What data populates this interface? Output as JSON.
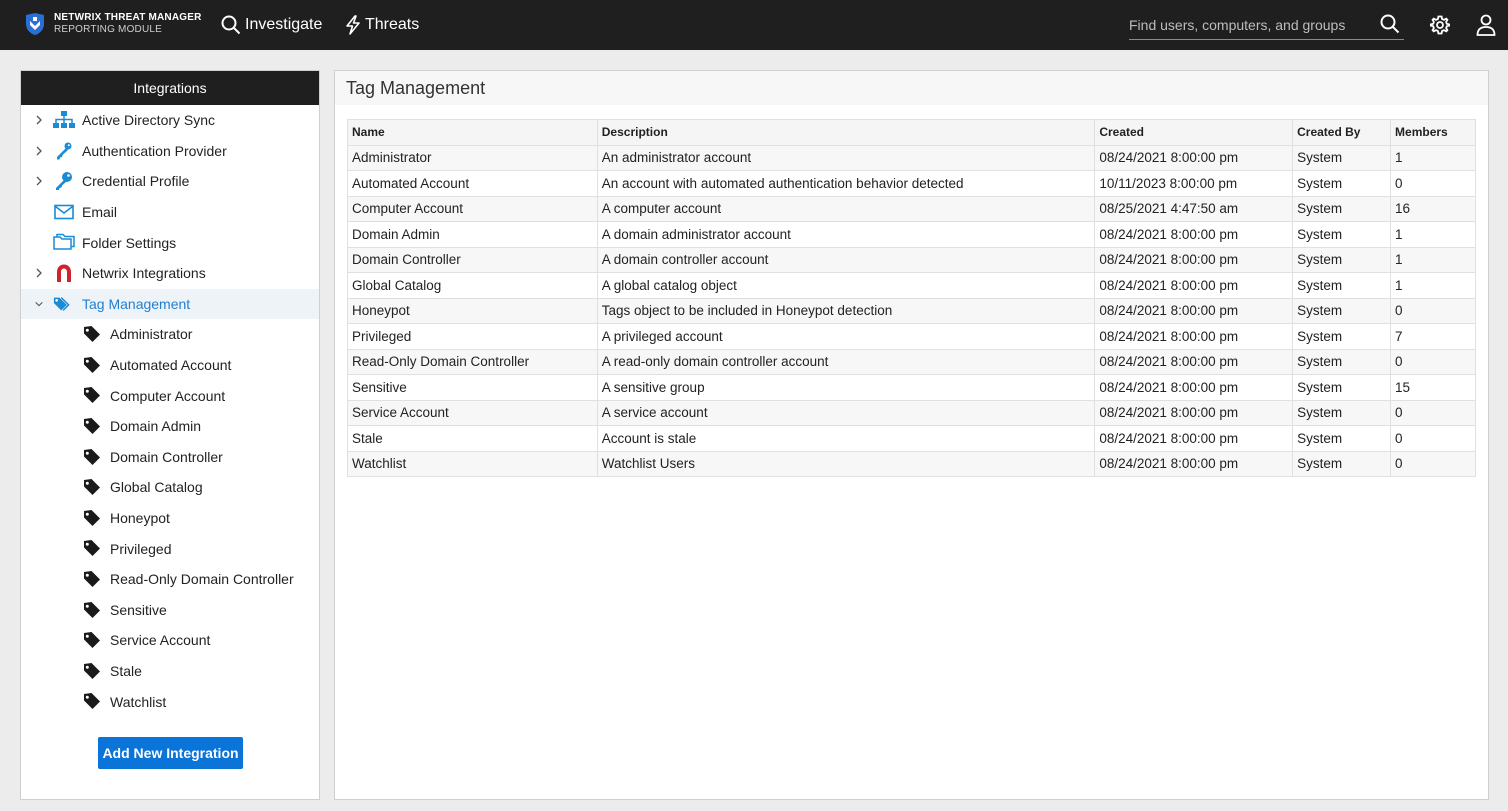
{
  "app": {
    "brand_line1": "NETWRIX THREAT MANAGER",
    "brand_line2": "REPORTING MODULE",
    "nav": [
      {
        "label": "Investigate",
        "icon": "search-icon"
      },
      {
        "label": "Threats",
        "icon": "lightning-icon"
      }
    ],
    "search_placeholder": "Find users, computers, and groups"
  },
  "sidebar": {
    "title": "Integrations",
    "items": [
      {
        "label": "Active Directory Sync",
        "icon": "network-icon",
        "expandable": true
      },
      {
        "label": "Authentication Provider",
        "icon": "key-icon",
        "expandable": true
      },
      {
        "label": "Credential Profile",
        "icon": "key-icon",
        "expandable": true
      },
      {
        "label": "Email",
        "icon": "envelope-icon",
        "expandable": false
      },
      {
        "label": "Folder Settings",
        "icon": "folder-icon",
        "expandable": false
      },
      {
        "label": "Netwrix Integrations",
        "icon": "magnet-icon",
        "expandable": true
      },
      {
        "label": "Tag Management",
        "icon": "tags-icon",
        "expandable": true,
        "expanded": true,
        "selected": true
      }
    ],
    "tag_children": [
      "Administrator",
      "Automated Account",
      "Computer Account",
      "Domain Admin",
      "Domain Controller",
      "Global Catalog",
      "Honeypot",
      "Privileged",
      "Read-Only Domain Controller",
      "Sensitive",
      "Service Account",
      "Stale",
      "Watchlist"
    ],
    "add_button": "Add New Integration"
  },
  "main": {
    "title": "Tag Management",
    "columns": [
      "Name",
      "Description",
      "Created",
      "Created By",
      "Members"
    ],
    "rows": [
      [
        "Administrator",
        "An administrator account",
        "08/24/2021 8:00:00 pm",
        "System",
        "1"
      ],
      [
        "Automated Account",
        "An account with automated authentication behavior detected",
        "10/11/2023 8:00:00 pm",
        "System",
        "0"
      ],
      [
        "Computer Account",
        "A computer account",
        "08/25/2021 4:47:50 am",
        "System",
        "16"
      ],
      [
        "Domain Admin",
        "A domain administrator account",
        "08/24/2021 8:00:00 pm",
        "System",
        "1"
      ],
      [
        "Domain Controller",
        "A domain controller account",
        "08/24/2021 8:00:00 pm",
        "System",
        "1"
      ],
      [
        "Global Catalog",
        "A global catalog object",
        "08/24/2021 8:00:00 pm",
        "System",
        "1"
      ],
      [
        "Honeypot",
        "Tags object to be included in Honeypot detection",
        "08/24/2021 8:00:00 pm",
        "System",
        "0"
      ],
      [
        "Privileged",
        "A privileged account",
        "08/24/2021 8:00:00 pm",
        "System",
        "7"
      ],
      [
        "Read-Only Domain Controller",
        "A read-only domain controller account",
        "08/24/2021 8:00:00 pm",
        "System",
        "0"
      ],
      [
        "Sensitive",
        "A sensitive group",
        "08/24/2021 8:00:00 pm",
        "System",
        "15"
      ],
      [
        "Service Account",
        "A service account",
        "08/24/2021 8:00:00 pm",
        "System",
        "0"
      ],
      [
        "Stale",
        "Account is stale",
        "08/24/2021 8:00:00 pm",
        "System",
        "0"
      ],
      [
        "Watchlist",
        "Watchlist Users",
        "08/24/2021 8:00:00 pm",
        "System",
        "0"
      ]
    ]
  },
  "colors": {
    "topbar": "#1f1f1f",
    "accent": "#1f7fd1",
    "button": "#0a74d8",
    "magnet": "#d0222f",
    "icon_blue": "#1a8bd6"
  }
}
